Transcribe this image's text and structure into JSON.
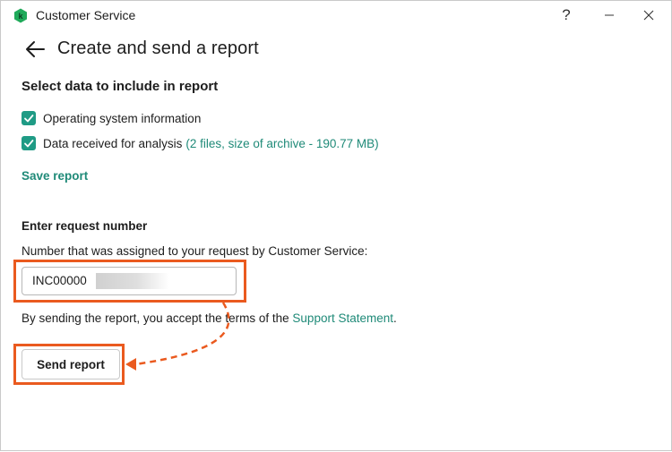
{
  "window": {
    "title": "Customer Service",
    "help_glyph": "?",
    "controls": [
      "minimize-icon",
      "close-icon"
    ]
  },
  "page": {
    "title": "Create and send a report",
    "back_icon": "back-arrow-icon"
  },
  "data_section": {
    "title": "Select data to include in report",
    "items": [
      {
        "label": "Operating system information",
        "checked": true,
        "detail": ""
      },
      {
        "label": "Data received for analysis",
        "checked": true,
        "detail": "(2 files, size of archive - 190.77 MB)"
      }
    ],
    "save_link": "Save report"
  },
  "request": {
    "title": "Enter request number",
    "description": "Number that was assigned to your request by Customer Service:",
    "value": "INC00000",
    "value_redacted": true
  },
  "terms": {
    "prefix": "By sending the report, you accept the terms of the ",
    "link": "Support Statement",
    "suffix": "."
  },
  "send_button": "Send report",
  "colors": {
    "accent": "#1f9b85",
    "link": "#1f8a78",
    "highlight": "#ea5a1f"
  }
}
